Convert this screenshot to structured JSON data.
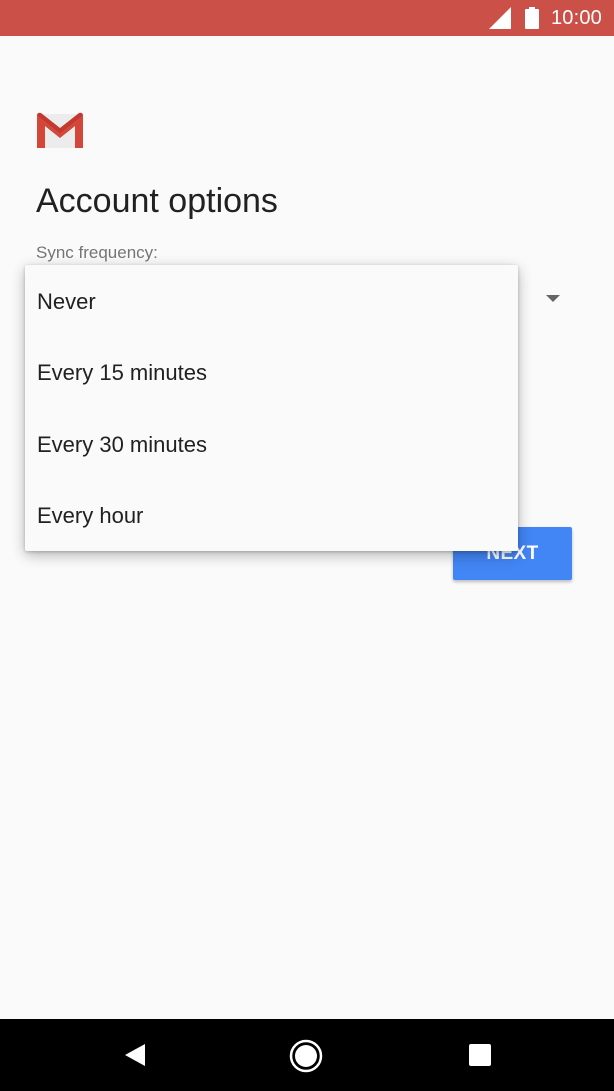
{
  "status_bar": {
    "time": "10:00",
    "icons": [
      "cell-signal-icon",
      "battery-icon"
    ],
    "color": "#cb5048"
  },
  "header": {
    "logo_icon": "gmail-logo-icon",
    "title": "Account options"
  },
  "sync": {
    "label": "Sync frequency:",
    "options": [
      "Never",
      "Every 15 minutes",
      "Every 30 minutes",
      "Every hour"
    ]
  },
  "actions": {
    "next_label": "NEXT",
    "next_color": "#4285f4"
  },
  "nav_bar": {
    "icons": [
      "back-icon",
      "home-icon",
      "recents-icon"
    ]
  }
}
